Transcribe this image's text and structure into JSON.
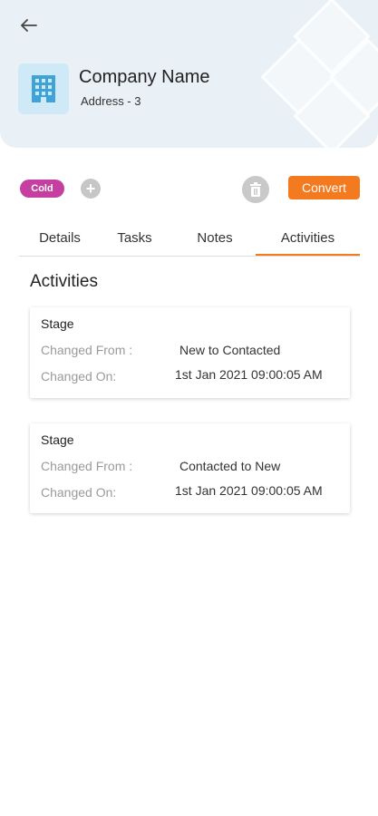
{
  "header": {
    "company_name": "Company Name",
    "address": "Address - 3",
    "back_icon": "arrow-left-icon",
    "logo_icon": "building-icon"
  },
  "actions": {
    "status_badge": "Cold",
    "add_icon": "plus-circle-icon",
    "delete_icon": "trash-icon",
    "convert_label": "Convert"
  },
  "tabs": [
    {
      "label": "Details"
    },
    {
      "label": "Tasks"
    },
    {
      "label": "Notes"
    },
    {
      "label": "Activities",
      "active": true
    }
  ],
  "section_title": "Activities",
  "activities": [
    {
      "title": "Stage",
      "changed_from_label": "Changed From :",
      "changed_from_value": "New to Contacted",
      "changed_on_label": "Changed On:",
      "changed_on_value": "1st Jan 2021 09:00:05 AM"
    },
    {
      "title": "Stage",
      "changed_from_label": "Changed From :",
      "changed_from_value": "Contacted to New",
      "changed_on_label": "Changed On:",
      "changed_on_value": "1st Jan 2021 09:00:05 AM"
    }
  ],
  "colors": {
    "accent": "#f47a20",
    "badge_cold": "#c43f9f",
    "header_bg": "#eaf1f6"
  }
}
